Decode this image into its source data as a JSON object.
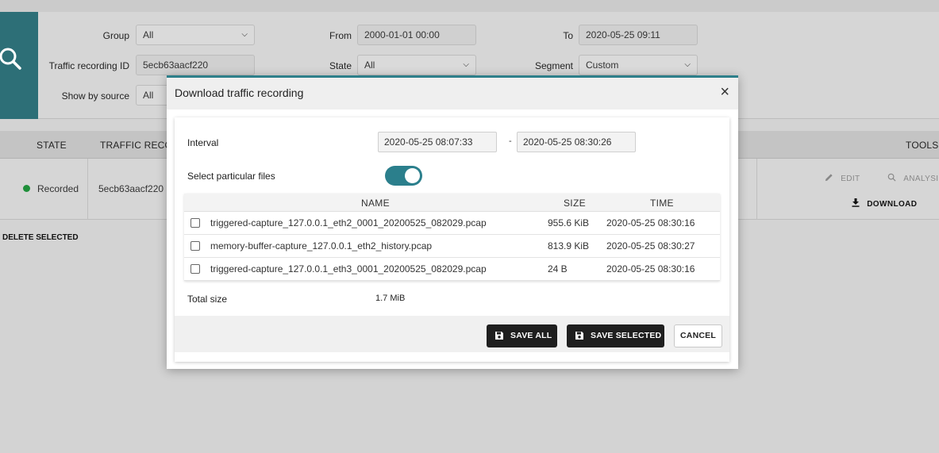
{
  "filters": {
    "group_label": "Group",
    "group_value": "All",
    "from_label": "From",
    "from_value": "2000-01-01 00:00",
    "to_label": "To",
    "to_value": "2020-05-25 09:11",
    "recording_id_label": "Traffic recording ID",
    "recording_id_value": "5ecb63aacf220",
    "state_label": "State",
    "state_value": "All",
    "segment_label": "Segment",
    "segment_value": "Custom",
    "show_by_source_label": "Show by source",
    "show_by_source_value": "All"
  },
  "table": {
    "headers": {
      "state": "STATE",
      "traffic_recording": "TRAFFIC RECO",
      "tools": "TOOLS"
    },
    "row": {
      "state": "Recorded",
      "id": "5ecb63aacf220",
      "edit": "EDIT",
      "analysis": "ANALYSI",
      "download": "DOWNLOAD"
    },
    "delete_selected": "DELETE SELECTED"
  },
  "modal": {
    "title": "Download traffic recording",
    "close": "×",
    "interval_label": "Interval",
    "interval_from": "2020-05-25 08:07:33",
    "interval_sep": "-",
    "interval_to": "2020-05-25 08:30:26",
    "select_files_label": "Select particular files",
    "select_files_on": true,
    "columns": {
      "name": "NAME",
      "size": "SIZE",
      "time": "TIME"
    },
    "files": [
      {
        "name": "triggered-capture_127.0.0.1_eth2_0001_20200525_082029.pcap",
        "size": "955.6 KiB",
        "time": "2020-05-25 08:30:16",
        "checked": false
      },
      {
        "name": "memory-buffer-capture_127.0.0.1_eth2_history.pcap",
        "size": "813.9 KiB",
        "time": "2020-05-25 08:30:27",
        "checked": false
      },
      {
        "name": "triggered-capture_127.0.0.1_eth3_0001_20200525_082029.pcap",
        "size": "24 B",
        "time": "2020-05-25 08:30:16",
        "checked": false
      }
    ],
    "total_size_label": "Total size",
    "total_size_value": "1.7 MiB",
    "save_all": "SAVE ALL",
    "save_selected": "SAVE SELECTED",
    "cancel": "CANCEL"
  },
  "colors": {
    "accent": "#2b7f8c",
    "recorded": "#1f8f3a",
    "button_dark": "#1f1f1f"
  },
  "icons": {
    "search": "search-icon",
    "edit": "pencil-icon",
    "analysis": "magnify-icon",
    "download": "download-icon",
    "save": "floppy-icon",
    "close": "close-icon"
  }
}
